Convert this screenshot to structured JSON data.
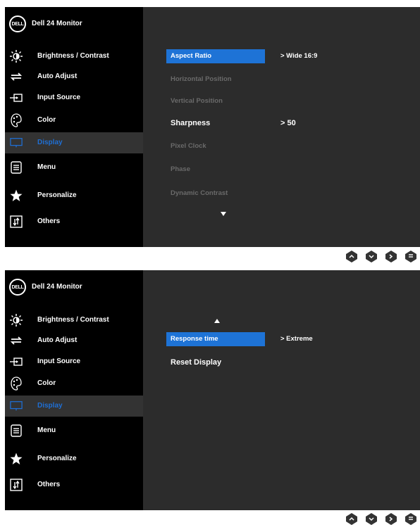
{
  "header": {
    "logo_text": "DELL",
    "title": "Dell 24 Monitor"
  },
  "sidebar": {
    "items": [
      {
        "label": "Brightness / Contrast",
        "icon": "brightness-icon"
      },
      {
        "label": "Auto Adjust",
        "icon": "auto-adjust-icon"
      },
      {
        "label": "Input Source",
        "icon": "input-source-icon"
      },
      {
        "label": "Color",
        "icon": "color-palette-icon"
      },
      {
        "label": "Display",
        "icon": "display-icon",
        "active": true
      },
      {
        "label": "Menu",
        "icon": "menu-icon"
      },
      {
        "label": "Personalize",
        "icon": "star-icon"
      },
      {
        "label": "Others",
        "icon": "others-icon"
      }
    ]
  },
  "top_panel": {
    "rows": [
      {
        "label": "Aspect Ratio",
        "value": "> Wide 16:9"
      },
      {
        "label": "Horizontal Position"
      },
      {
        "label": "Vertical Position"
      },
      {
        "label": "Sharpness",
        "value": ">  50"
      },
      {
        "label": "Pixel Clock"
      },
      {
        "label": "Phase"
      },
      {
        "label": "Dynamic Contrast"
      }
    ]
  },
  "bottom_panel": {
    "rows": [
      {
        "label": "Response time",
        "value": ">  Extreme"
      },
      {
        "label": "Reset Display"
      }
    ]
  },
  "buttons": [
    "up-button",
    "down-button",
    "right-button",
    "exit-button"
  ],
  "colors": {
    "selected_bg": "#1e73d6",
    "active_label": "#1f6fd4",
    "panel_bg": "#2c2c2c",
    "sidebar_bg": "#000000"
  }
}
